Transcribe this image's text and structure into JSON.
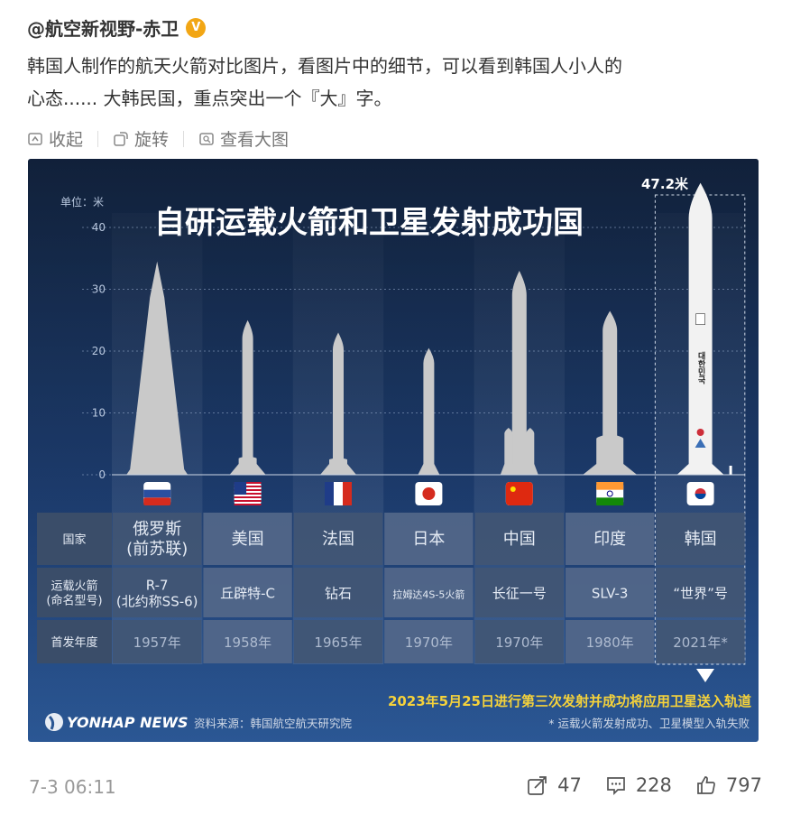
{
  "post": {
    "author": "@航空新视野-赤卫",
    "verified_badge": "V",
    "text_line1": "韩国人制作的航天火箭对比图片，看图片中的细节，可以看到韩国人小人的",
    "text_line2": "心态...... 大韩民国，重点突出一个『大』字。"
  },
  "toolbar": {
    "collapse_label": "收起",
    "rotate_label": "旋转",
    "view_large_label": "查看大图"
  },
  "infographic": {
    "title": "自研运载火箭和卫星发射成功国",
    "unit_label": "单位：米",
    "height_callout": "47.2米",
    "y_ticks": [
      "40",
      "30",
      "20",
      "10",
      "0"
    ],
    "row_headers": [
      "国家",
      "运载火箭\n(命名型号)",
      "首发年度"
    ],
    "columns": [
      {
        "country": "俄罗斯\n(前苏联)",
        "rocket": "R-7\n(北约称SS-6)",
        "year": "1957年",
        "height_m": 34.5,
        "flag": "russia-flag"
      },
      {
        "country": "美国",
        "rocket": "丘辟特-C",
        "year": "1958年",
        "height_m": 25,
        "flag": "usa-flag"
      },
      {
        "country": "法国",
        "rocket": "钻石",
        "year": "1965年",
        "height_m": 23,
        "flag": "france-flag"
      },
      {
        "country": "日本",
        "rocket": "拉姆达4S-5火箭",
        "year": "1970年",
        "height_m": 20.5,
        "flag": "japan-flag"
      },
      {
        "country": "中国",
        "rocket": "长征一号",
        "year": "1970年",
        "height_m": 33,
        "flag": "china-flag"
      },
      {
        "country": "印度",
        "rocket": "SLV-3",
        "year": "1980年",
        "height_m": 26.5,
        "flag": "india-flag"
      },
      {
        "country": "韩国",
        "rocket": "“世界”号",
        "year": "2021年*",
        "height_m": 47.2,
        "flag": "korea-flag"
      }
    ],
    "korea_rocket_text": "대한민국",
    "highlight_note": "2023年5月25日进行第三次发射并成功将应用卫星送入轨道",
    "footnote": "* 运载火箭发射成功、卫星模型入轨失败",
    "source": "资料来源：韩国航空航天研究院",
    "logo_text": "YONHAP NEWS",
    "y_max": 40,
    "colors": {
      "title": "#ffffff",
      "highlight": "#f5d23b",
      "rocket": "#c9c9c9",
      "korea_rocket": "#f2f2f2"
    }
  },
  "footer": {
    "timestamp": "7-3 06:11",
    "share_count": "47",
    "comment_count": "228",
    "like_count": "797"
  }
}
